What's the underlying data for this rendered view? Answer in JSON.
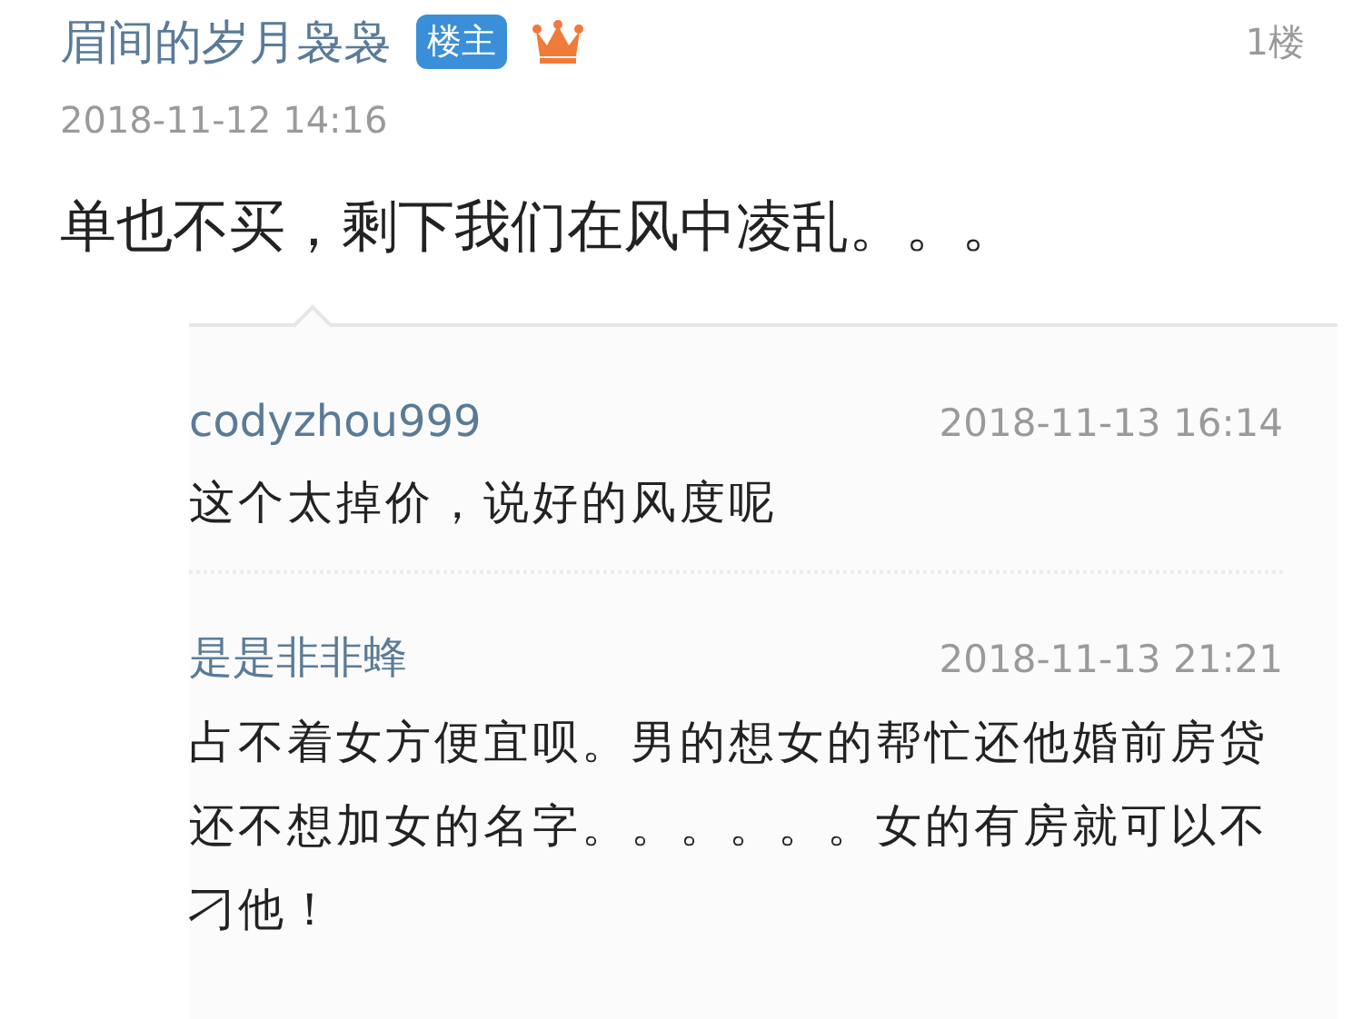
{
  "post": {
    "author": "眉间的岁月袅袅",
    "badge": "楼主",
    "floor": "1楼",
    "time": "2018-11-12 14:16",
    "content": "单也不买，剩下我们在风中凌乱。。。"
  },
  "replies": [
    {
      "author": "codyzhou999",
      "time": "2018-11-13 16:14",
      "content": "这个太掉价，说好的风度呢"
    },
    {
      "author": "是是非非蜂",
      "time": "2018-11-13 21:21",
      "content": "占不着女方便宜呗。男的想女的帮忙还他婚前房贷还不想加女的名字。。。。。。女的有房就可以不刁他！"
    }
  ]
}
